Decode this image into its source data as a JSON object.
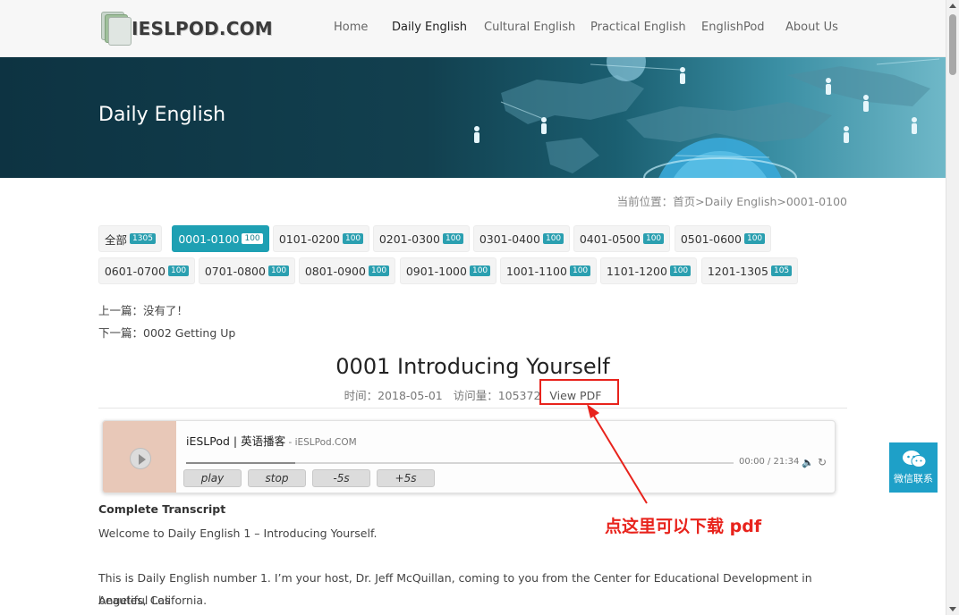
{
  "header": {
    "logo_text": "IESLPOD.COM",
    "nav": [
      "Home",
      "Daily English",
      "Cultural English",
      "Practical English",
      "EnglishPod",
      "About Us"
    ],
    "active_nav": "Daily English"
  },
  "banner": {
    "title": "Daily English"
  },
  "breadcrumb": "当前位置：首页>Daily English>0001-0100",
  "categories": [
    {
      "label": "全部",
      "count": "1305"
    },
    {
      "label": "0001-0100",
      "count": "100"
    },
    {
      "label": "0101-0200",
      "count": "100"
    },
    {
      "label": "0201-0300",
      "count": "100"
    },
    {
      "label": "0301-0400",
      "count": "100"
    },
    {
      "label": "0401-0500",
      "count": "100"
    },
    {
      "label": "0501-0600",
      "count": "100"
    },
    {
      "label": "0601-0700",
      "count": "100"
    },
    {
      "label": "0701-0800",
      "count": "100"
    },
    {
      "label": "0801-0900",
      "count": "100"
    },
    {
      "label": "0901-1000",
      "count": "100"
    },
    {
      "label": "1001-1100",
      "count": "100"
    },
    {
      "label": "1101-1200",
      "count": "100"
    },
    {
      "label": "1201-1305",
      "count": "105"
    }
  ],
  "active_category": "0001-0100",
  "prev_link": "上一篇：没有了！",
  "next_link": "下一篇：0002 Getting Up",
  "article": {
    "title": "0001 Introducing Yourself",
    "time": "时间：2018-05-01",
    "views": "访问量：105372",
    "view_pdf": "View PDF"
  },
  "player": {
    "title": "iESLPod | 英语播客",
    "subtitle": " - iESLPod.COM",
    "time": "00:00 / 21:34",
    "progress": 0.2,
    "buttons": [
      "play",
      "stop",
      "-5s",
      "+5s"
    ]
  },
  "annotation": "点这里可以下载 pdf",
  "transcript": {
    "heading": "Complete Transcript",
    "para1": "Welcome to Daily English 1 – Introducing Yourself.",
    "para2_line1": "This is Daily English number 1. I’m your host, Dr. Jeff McQuillan, coming to you from the Center for Educational Development in beautiful Los",
    "para2_line2": "Angeles, California."
  },
  "wechat": {
    "label": "微信联系"
  },
  "colors": {
    "accent": "#1ea0b3",
    "annotation": "#e8231c",
    "wechat": "#1ea0c8"
  }
}
